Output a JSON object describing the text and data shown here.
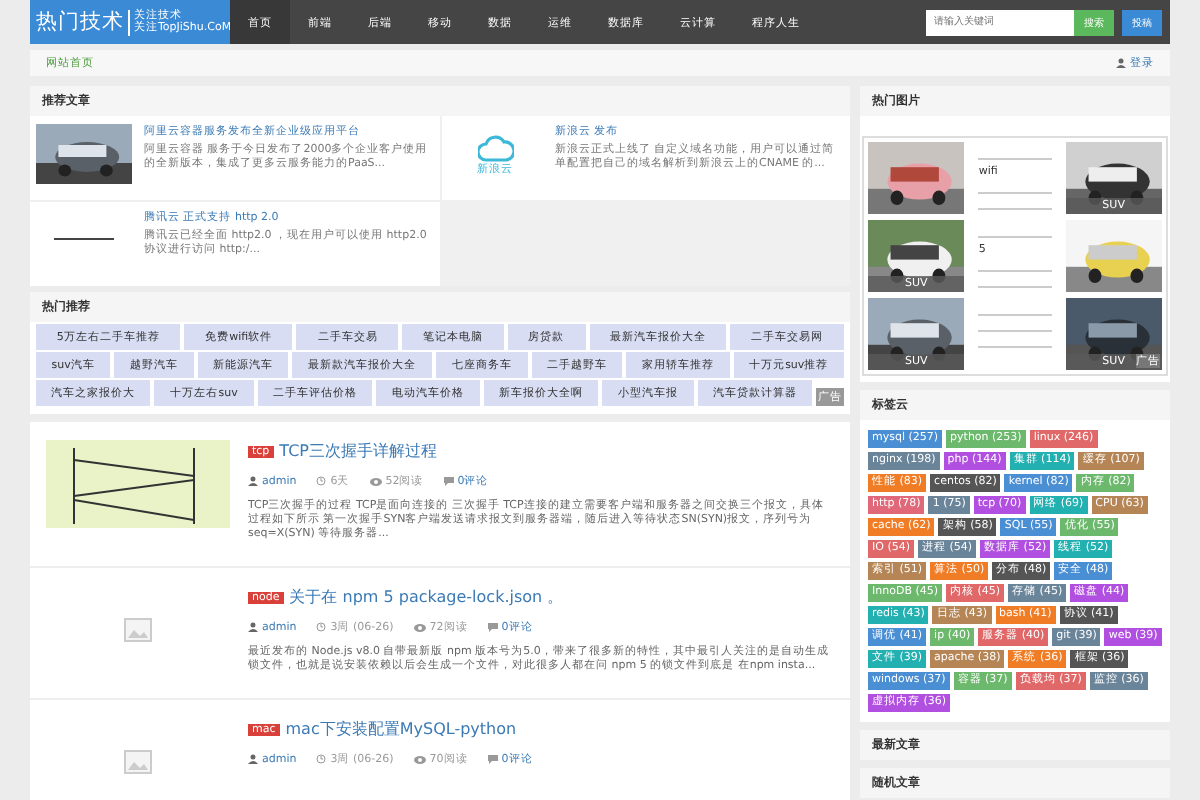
{
  "header": {
    "logo": "热门技术",
    "logo_sub": [
      "关注技术",
      "关注TopJiShu.CoM"
    ],
    "nav": [
      {
        "label": "首页",
        "selected": true
      },
      {
        "label": "前端",
        "selected": false
      },
      {
        "label": "后端",
        "selected": false
      },
      {
        "label": "移动",
        "selected": false
      },
      {
        "label": "数据",
        "selected": false
      },
      {
        "label": "运维",
        "selected": false
      },
      {
        "label": "数据库",
        "selected": false
      },
      {
        "label": "云计算",
        "selected": false
      },
      {
        "label": "程序人生",
        "selected": false
      }
    ],
    "search": {
      "placeholder": "请输入关键词",
      "button": "搜索"
    },
    "post_button": "投稿"
  },
  "breadcrumb": {
    "current": "网站首页",
    "login": "登录"
  },
  "recommended": {
    "title": "推荐文章",
    "items": [
      {
        "title": "阿里云容器服务发布全新企业级应用平台",
        "excerpt": "阿里云容器 服务于今日发布了2000多个企业客户使用的全新版本，集成了更多云服务能力的PaaS..."
      },
      {
        "kind": "logo",
        "logo_text": "新浪云",
        "title": "新浪云 发布",
        "excerpt": "新浪云正式上线了 自定义域名功能，用户可以通过简单配置把自己的域名解析到新浪云上的CNAME 的..."
      },
      {
        "kind": "blank",
        "title": "腾讯云 正式支持 http 2.0",
        "excerpt": "腾讯云已经全面 http2.0 ，现在用户可以使用 http2.0 协议进行访问 http:/..."
      }
    ]
  },
  "hot_links": {
    "title": "热门推荐",
    "badge": "广告",
    "rows": [
      {
        "links": [
          "5万左右二手车推荐",
          "免费wifi软件",
          "二手车交易",
          "笔记本电脑",
          "房贷款",
          "最新汽车报价大全",
          "二手车交易网"
        ]
      },
      {
        "links": [
          "suv汽车",
          "越野汽车",
          "新能源汽车",
          "最新款汽车报价大全",
          "七座商务车",
          "二手越野车",
          "家用轿车推荐",
          "十万元suv推荐"
        ]
      },
      {
        "links": [
          "汽车之家报价大",
          "十万左右suv",
          "二手车评估价格",
          "电动汽车价格",
          "新车报价大全啊",
          "小型汽车报",
          "汽车贷款计算器"
        ]
      }
    ]
  },
  "articles": [
    {
      "tag": "tcp",
      "title": "TCP三次握手详解过程",
      "author": "admin",
      "time": "6天",
      "views": "52阅读",
      "comments": "0评论",
      "excerpt": "TCP三次握手的过程 TCP是面向连接的 三次握手 TCP连接的建立需要客户端和服务器之间交换三个报文，具体过程如下所示 第一次握手SYN客户端发送请求报文到服务器端，随后进入等待状态SN(SYN)报文，序列号为seq=X(SYN) 等待服务器...",
      "kind": "diagram"
    },
    {
      "tag": "node",
      "title": "关于在 npm 5 package-lock.json 。",
      "author": "admin",
      "time": "3周 (06-26)",
      "views": "72阅读",
      "comments": "0评论",
      "excerpt": "最近发布的 Node.js v8.0 自带最新版 npm 版本号为5.0，带来了很多新的特性，其中最引人关注的是自动生成锁文件，也就是说安装依赖以后会生成一个文件，对此很多人都在问 npm 5 的锁文件到底是 在npm insta...",
      "kind": "placeholder"
    },
    {
      "tag": "mac",
      "title": "mac下安装配置MySQL-python",
      "author": "admin",
      "time": "3周 (06-26)",
      "views": "70阅读",
      "comments": "0评论",
      "kind": "placeholder"
    }
  ],
  "hot_images": {
    "title": "热门图片",
    "cells": [
      {
        "kind": "picture"
      },
      {
        "kind": "text",
        "lines": [
          "wifi"
        ]
      },
      {
        "kind": "picture",
        "caption": "SUV"
      },
      {
        "kind": "picture",
        "caption": "SUV"
      },
      {
        "kind": "text",
        "lines": [
          "5"
        ]
      },
      {
        "kind": "picture"
      },
      {
        "kind": "picture",
        "caption": "SUV"
      },
      {
        "kind": "text"
      },
      {
        "kind": "picture",
        "caption": "SUV",
        "badge": "广告"
      }
    ]
  },
  "tag_cloud": {
    "title": "标签云",
    "tags": [
      {
        "label": "mysql (257)",
        "color": "#4a8fd4"
      },
      {
        "label": "python (253)",
        "color": "#6cb86c"
      },
      {
        "label": "linux (246)",
        "color": "#e06868"
      },
      {
        "label": "nginx (198)",
        "color": "#6a8499"
      },
      {
        "label": "php (144)",
        "color": "#b150e0"
      },
      {
        "label": "集群 (114)",
        "color": "#22b0b0"
      },
      {
        "label": "缓存 (107)",
        "color": "#b58556"
      },
      {
        "label": "性能 (83)",
        "color": "#f07d26"
      },
      {
        "label": "centos (82)",
        "color": "#555555"
      },
      {
        "label": "kernel (82)",
        "color": "#4a8fd4"
      },
      {
        "label": "内存 (82)",
        "color": "#6cb86c"
      },
      {
        "label": "http (78)",
        "color": "#e06878"
      },
      {
        "label": "1 (75)",
        "color": "#6a8499"
      },
      {
        "label": "tcp (70)",
        "color": "#b150e0"
      },
      {
        "label": "网络 (69)",
        "color": "#22b0b0"
      },
      {
        "label": "CPU (63)",
        "color": "#b58556"
      },
      {
        "label": "cache (62)",
        "color": "#f07d26"
      },
      {
        "label": "架构 (58)",
        "color": "#555555"
      },
      {
        "label": "SQL (55)",
        "color": "#4a8fd4"
      },
      {
        "label": "优化 (55)",
        "color": "#6cb86c"
      },
      {
        "label": "IO (54)",
        "color": "#e06868"
      },
      {
        "label": "进程 (54)",
        "color": "#6a8499"
      },
      {
        "label": "数据库 (52)",
        "color": "#b150e0"
      },
      {
        "label": "线程 (52)",
        "color": "#22b0b0"
      },
      {
        "label": "索引 (51)",
        "color": "#b58556"
      },
      {
        "label": "算法 (50)",
        "color": "#f07d26"
      },
      {
        "label": "分布 (48)",
        "color": "#555555"
      },
      {
        "label": "安全 (48)",
        "color": "#4a8fd4"
      },
      {
        "label": "InnoDB (45)",
        "color": "#6cb86c"
      },
      {
        "label": "内核 (45)",
        "color": "#e06868"
      },
      {
        "label": "存储 (45)",
        "color": "#6a8499"
      },
      {
        "label": "磁盘 (44)",
        "color": "#b150e0"
      },
      {
        "label": "redis (43)",
        "color": "#22b0b0"
      },
      {
        "label": "日志 (43)",
        "color": "#b58556"
      },
      {
        "label": "bash (41)",
        "color": "#f07d26"
      },
      {
        "label": "协议 (41)",
        "color": "#555555"
      },
      {
        "label": "调优 (41)",
        "color": "#4a8fd4"
      },
      {
        "label": "ip (40)",
        "color": "#6cb86c"
      },
      {
        "label": "服务器 (40)",
        "color": "#e06868"
      },
      {
        "label": "git (39)",
        "color": "#6a8499"
      },
      {
        "label": "web (39)",
        "color": "#b150e0"
      },
      {
        "label": "文件 (39)",
        "color": "#22b0b0"
      },
      {
        "label": "apache (38)",
        "color": "#b58556"
      },
      {
        "label": "系统 (36)",
        "color": "#f07d26"
      },
      {
        "label": "框架 (36)",
        "color": "#555555"
      },
      {
        "label": "windows (37)",
        "color": "#4a8fd4"
      },
      {
        "label": "容器 (37)",
        "color": "#6cb86c"
      },
      {
        "label": "负载均 (37)",
        "color": "#e06868"
      },
      {
        "label": "监控 (36)",
        "color": "#6a8499"
      },
      {
        "label": "虚拟内存 (36)",
        "color": "#b150e0"
      }
    ]
  },
  "widgets": [
    "最新文章",
    "随机文章"
  ]
}
